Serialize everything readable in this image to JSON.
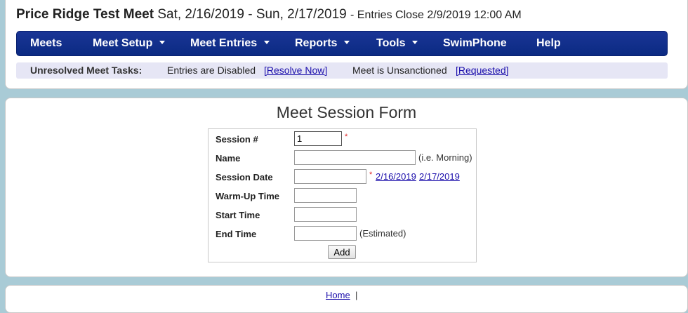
{
  "meet": {
    "name": "Price Ridge Test Meet",
    "dates": "Sat, 2/16/2019 - Sun, 2/17/2019",
    "entries_close": "- Entries Close 2/9/2019 12:00 AM"
  },
  "nav": {
    "items": [
      {
        "label": "Meets"
      },
      {
        "label": "Meet Setup"
      },
      {
        "label": "Meet Entries"
      },
      {
        "label": "Reports"
      },
      {
        "label": "Tools"
      },
      {
        "label": "SwimPhone"
      },
      {
        "label": "Help"
      }
    ],
    "background": "#0b2a82"
  },
  "tasks": {
    "label": "Unresolved Meet Tasks:",
    "item1_text": "Entries are Disabled",
    "item1_link": "[Resolve Now]",
    "item2_text": "Meet is Unsanctioned",
    "item2_link": "[Requested]"
  },
  "form": {
    "title": "Meet Session Form",
    "session_label": "Session #",
    "session_value": "1",
    "required_mark": "*",
    "name_label": "Name",
    "name_hint": "(i.e. Morning)",
    "date_label": "Session Date",
    "date_option_1": "2/16/2019",
    "date_option_2": "2/17/2019",
    "warmup_label": "Warm-Up Time",
    "start_label": "Start Time",
    "end_label": "End Time",
    "end_hint": "(Estimated)",
    "add_label": "Add"
  },
  "footer": {
    "home_link": "Home",
    "separator": "|"
  }
}
